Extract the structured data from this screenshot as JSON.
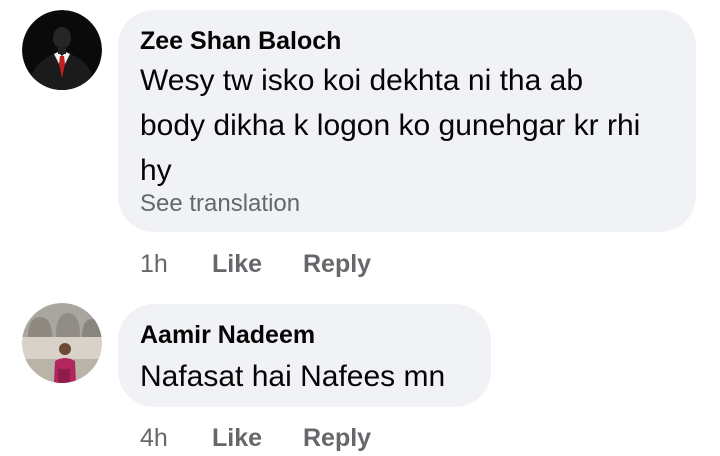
{
  "comments": [
    {
      "author": "Zee Shan Baloch",
      "avatar_icon": "suit-avatar-icon",
      "lines": [
        "Wesy tw isko koi dekhta ni tha ab",
        "body dikha k logon ko gunehgar kr rhi",
        "hy"
      ],
      "see_translation": "See translation",
      "time": "1h",
      "like": "Like",
      "reply": "Reply"
    },
    {
      "author": "Aamir Nadeem",
      "avatar_icon": "person-photo-avatar-icon",
      "lines": [
        "Nafasat hai Nafees mn"
      ],
      "time": "4h",
      "like": "Like",
      "reply": "Reply"
    }
  ],
  "colors": {
    "bubble": "#f0f2f5",
    "text": "#050505",
    "meta": "#65676b"
  }
}
